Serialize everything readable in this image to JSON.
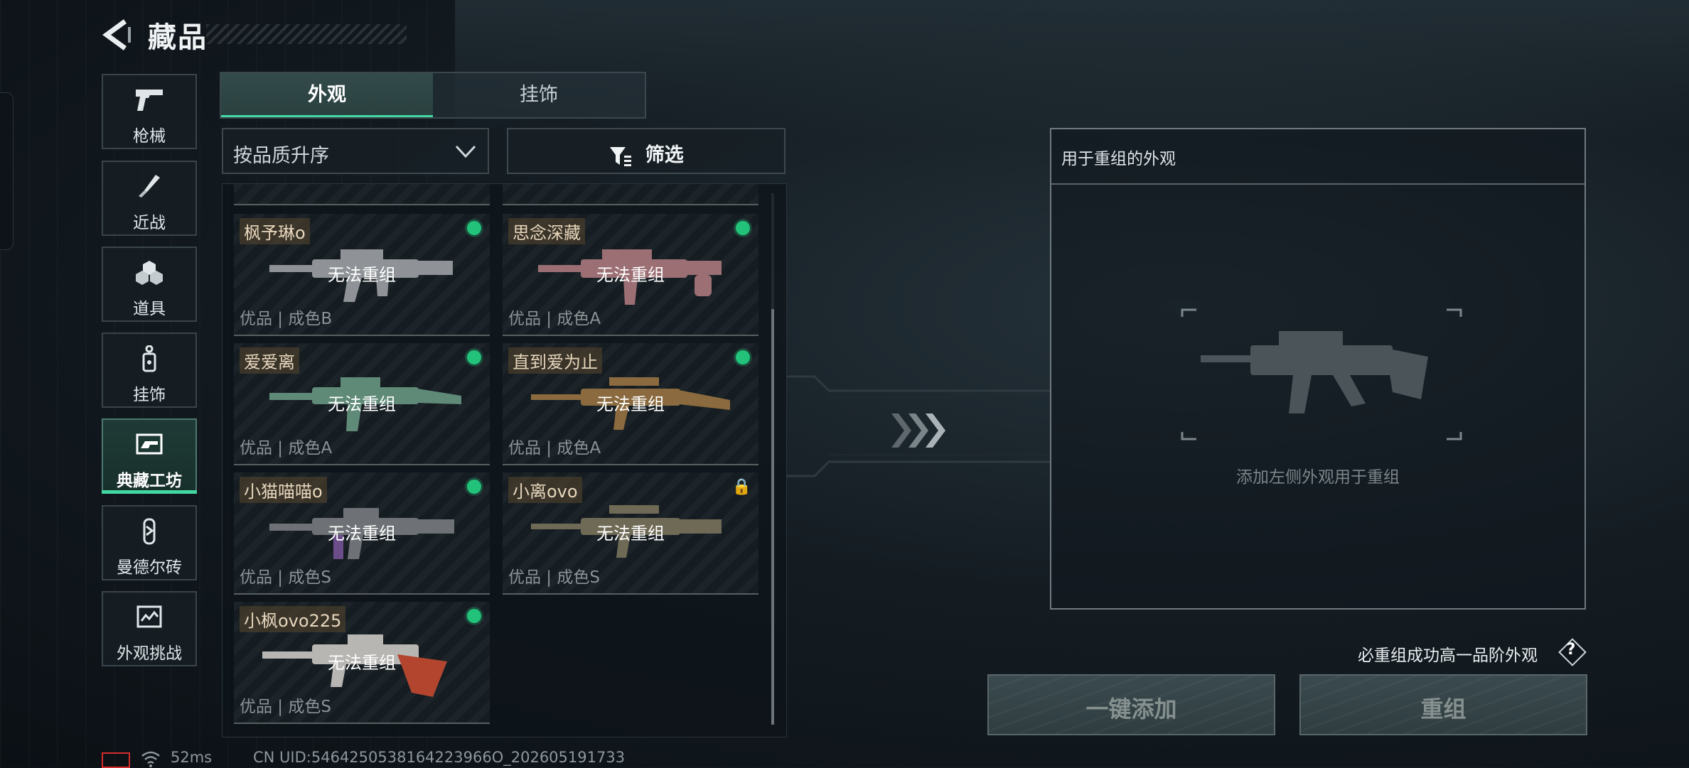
{
  "header": {
    "title": "藏品"
  },
  "sidebar": {
    "items": [
      {
        "label": "枪械",
        "icon": "pistol-icon"
      },
      {
        "label": "近战",
        "icon": "knife-icon"
      },
      {
        "label": "道具",
        "icon": "grenade-icon"
      },
      {
        "label": "挂饰",
        "icon": "charm-icon"
      },
      {
        "label": "典藏工坊",
        "icon": "workshop-icon",
        "active": true
      },
      {
        "label": "曼德尔砖",
        "icon": "brick-icon"
      },
      {
        "label": "外观挑战",
        "icon": "challenge-icon"
      }
    ]
  },
  "tabs": [
    {
      "label": "外观",
      "active": true
    },
    {
      "label": "挂饰"
    }
  ],
  "sort": {
    "selected": "按品质升序"
  },
  "filter": {
    "label": "筛选"
  },
  "cards": [
    {
      "name": "枫予琳o",
      "status": "无法重组",
      "quality": "优品 | 成色B",
      "equipped": true,
      "gun_color": "#8f9397"
    },
    {
      "name": "思念深藏",
      "status": "无法重组",
      "quality": "优品 | 成色A",
      "equipped": true,
      "gun_color": "#9b6f74"
    },
    {
      "name": "爱爱离",
      "status": "无法重组",
      "quality": "优品 | 成色A",
      "equipped": true,
      "gun_color": "#5f8a78"
    },
    {
      "name": "直到爱为止",
      "status": "无法重组",
      "quality": "优品 | 成色A",
      "equipped": true,
      "gun_color": "#8a6a3e"
    },
    {
      "name": "小猫喵喵o",
      "status": "无法重组",
      "quality": "优品 | 成色S",
      "equipped": true,
      "gun_color": "#6e7276"
    },
    {
      "name": "小离ovo",
      "status": "无法重组",
      "quality": "优品 | 成色S",
      "equipped": false,
      "locked": true,
      "gun_color": "#6f6a55"
    },
    {
      "name": "小枫ovo225",
      "status": "无法重组",
      "quality": "优品 | 成色S",
      "equipped": true,
      "gun_color": "#b8b6b3"
    }
  ],
  "target": {
    "header": "用于重组的外观",
    "hint": "添加左侧外观用于重组"
  },
  "guarantee": "必重组成功高一品阶外观",
  "help": "?",
  "buttons": {
    "add_all": "一键添加",
    "reassemble": "重组"
  },
  "status": {
    "ping": "52ms",
    "uid": "CN UID:5464250538164223966O_202605191733"
  },
  "colors": {
    "accent": "#43d7a2",
    "equipped_dot": "#22c27a",
    "battery_low": "#d42c2c"
  }
}
